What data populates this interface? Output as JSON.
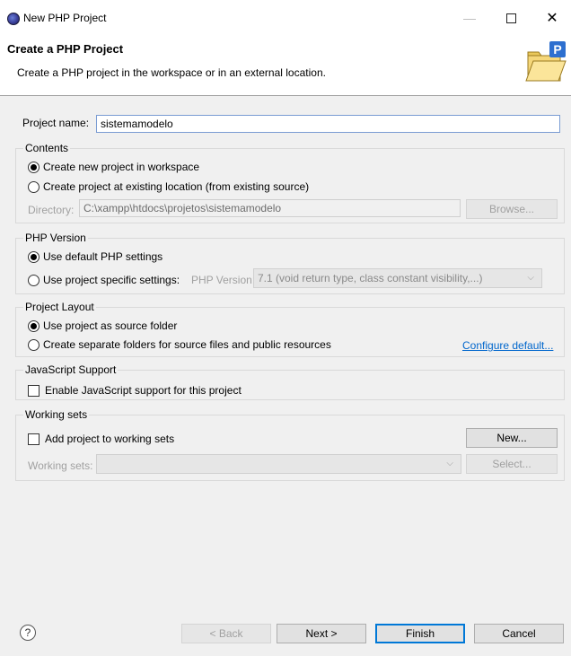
{
  "window": {
    "title": "New PHP Project"
  },
  "header": {
    "title": "Create a PHP Project",
    "description": "Create a PHP project in the workspace or in an external location."
  },
  "project_name": {
    "label": "Project name:",
    "value": "sistemamodelo"
  },
  "contents": {
    "legend": "Contents",
    "option_workspace": "Create new project in workspace",
    "option_existing": "Create project at existing location (from existing source)",
    "selected": "workspace",
    "directory_label": "Directory:",
    "directory_value": "C:\\xampp\\htdocs\\projetos\\sistemamodelo",
    "browse_label": "Browse..."
  },
  "php_version": {
    "legend": "PHP Version",
    "option_default": "Use default PHP settings",
    "option_specific": "Use project specific settings:",
    "selected": "default",
    "version_label": "PHP Version:",
    "version_value": "7.1 (void return type, class constant visibility,...)"
  },
  "project_layout": {
    "legend": "Project Layout",
    "option_source": "Use project as source folder",
    "option_separate": "Create separate folders for source files and public resources",
    "selected": "source",
    "configure_link": "Configure default..."
  },
  "javascript": {
    "legend": "JavaScript Support",
    "enable_label": "Enable JavaScript support for this project",
    "enabled": false
  },
  "working_sets": {
    "legend": "Working sets",
    "add_label": "Add project to working sets",
    "checked": false,
    "new_label": "New...",
    "sets_label": "Working sets:",
    "select_label": "Select..."
  },
  "footer": {
    "help_glyph": "?",
    "back_label": "< Back",
    "next_label": "Next >",
    "finish_label": "Finish",
    "cancel_label": "Cancel"
  },
  "colors": {
    "accent": "#0078d7",
    "link": "#0066cc"
  }
}
